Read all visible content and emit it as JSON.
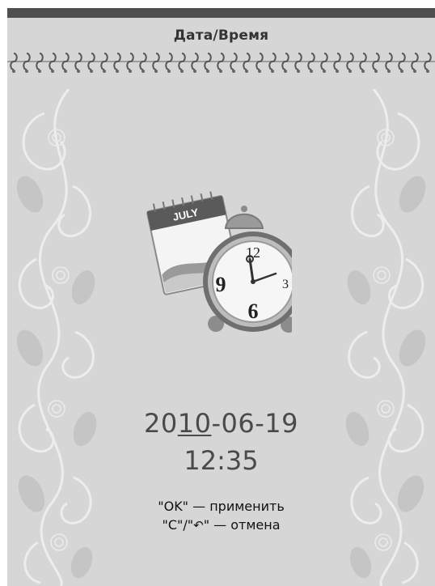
{
  "header": {
    "title": "Дата/Время"
  },
  "datetime": {
    "date_prefix": "20",
    "date_cursor": "10",
    "date_suffix": "-06-19",
    "time": "12:35"
  },
  "hints": {
    "ok_key": "\"OK\"",
    "ok_action": " — применить",
    "cancel_keys_a": "\"C\"/\"",
    "cancel_undo_glyph": "↶",
    "cancel_keys_b": "\"",
    "cancel_action": " — отмена"
  },
  "icon": {
    "calendar_month": "JULY",
    "clock_numbers": [
      "12",
      "3",
      "6",
      "9"
    ]
  },
  "colors": {
    "background": "#d6d6d6",
    "top_bar": "#4f4f4f",
    "text": "#4a4a4a"
  }
}
